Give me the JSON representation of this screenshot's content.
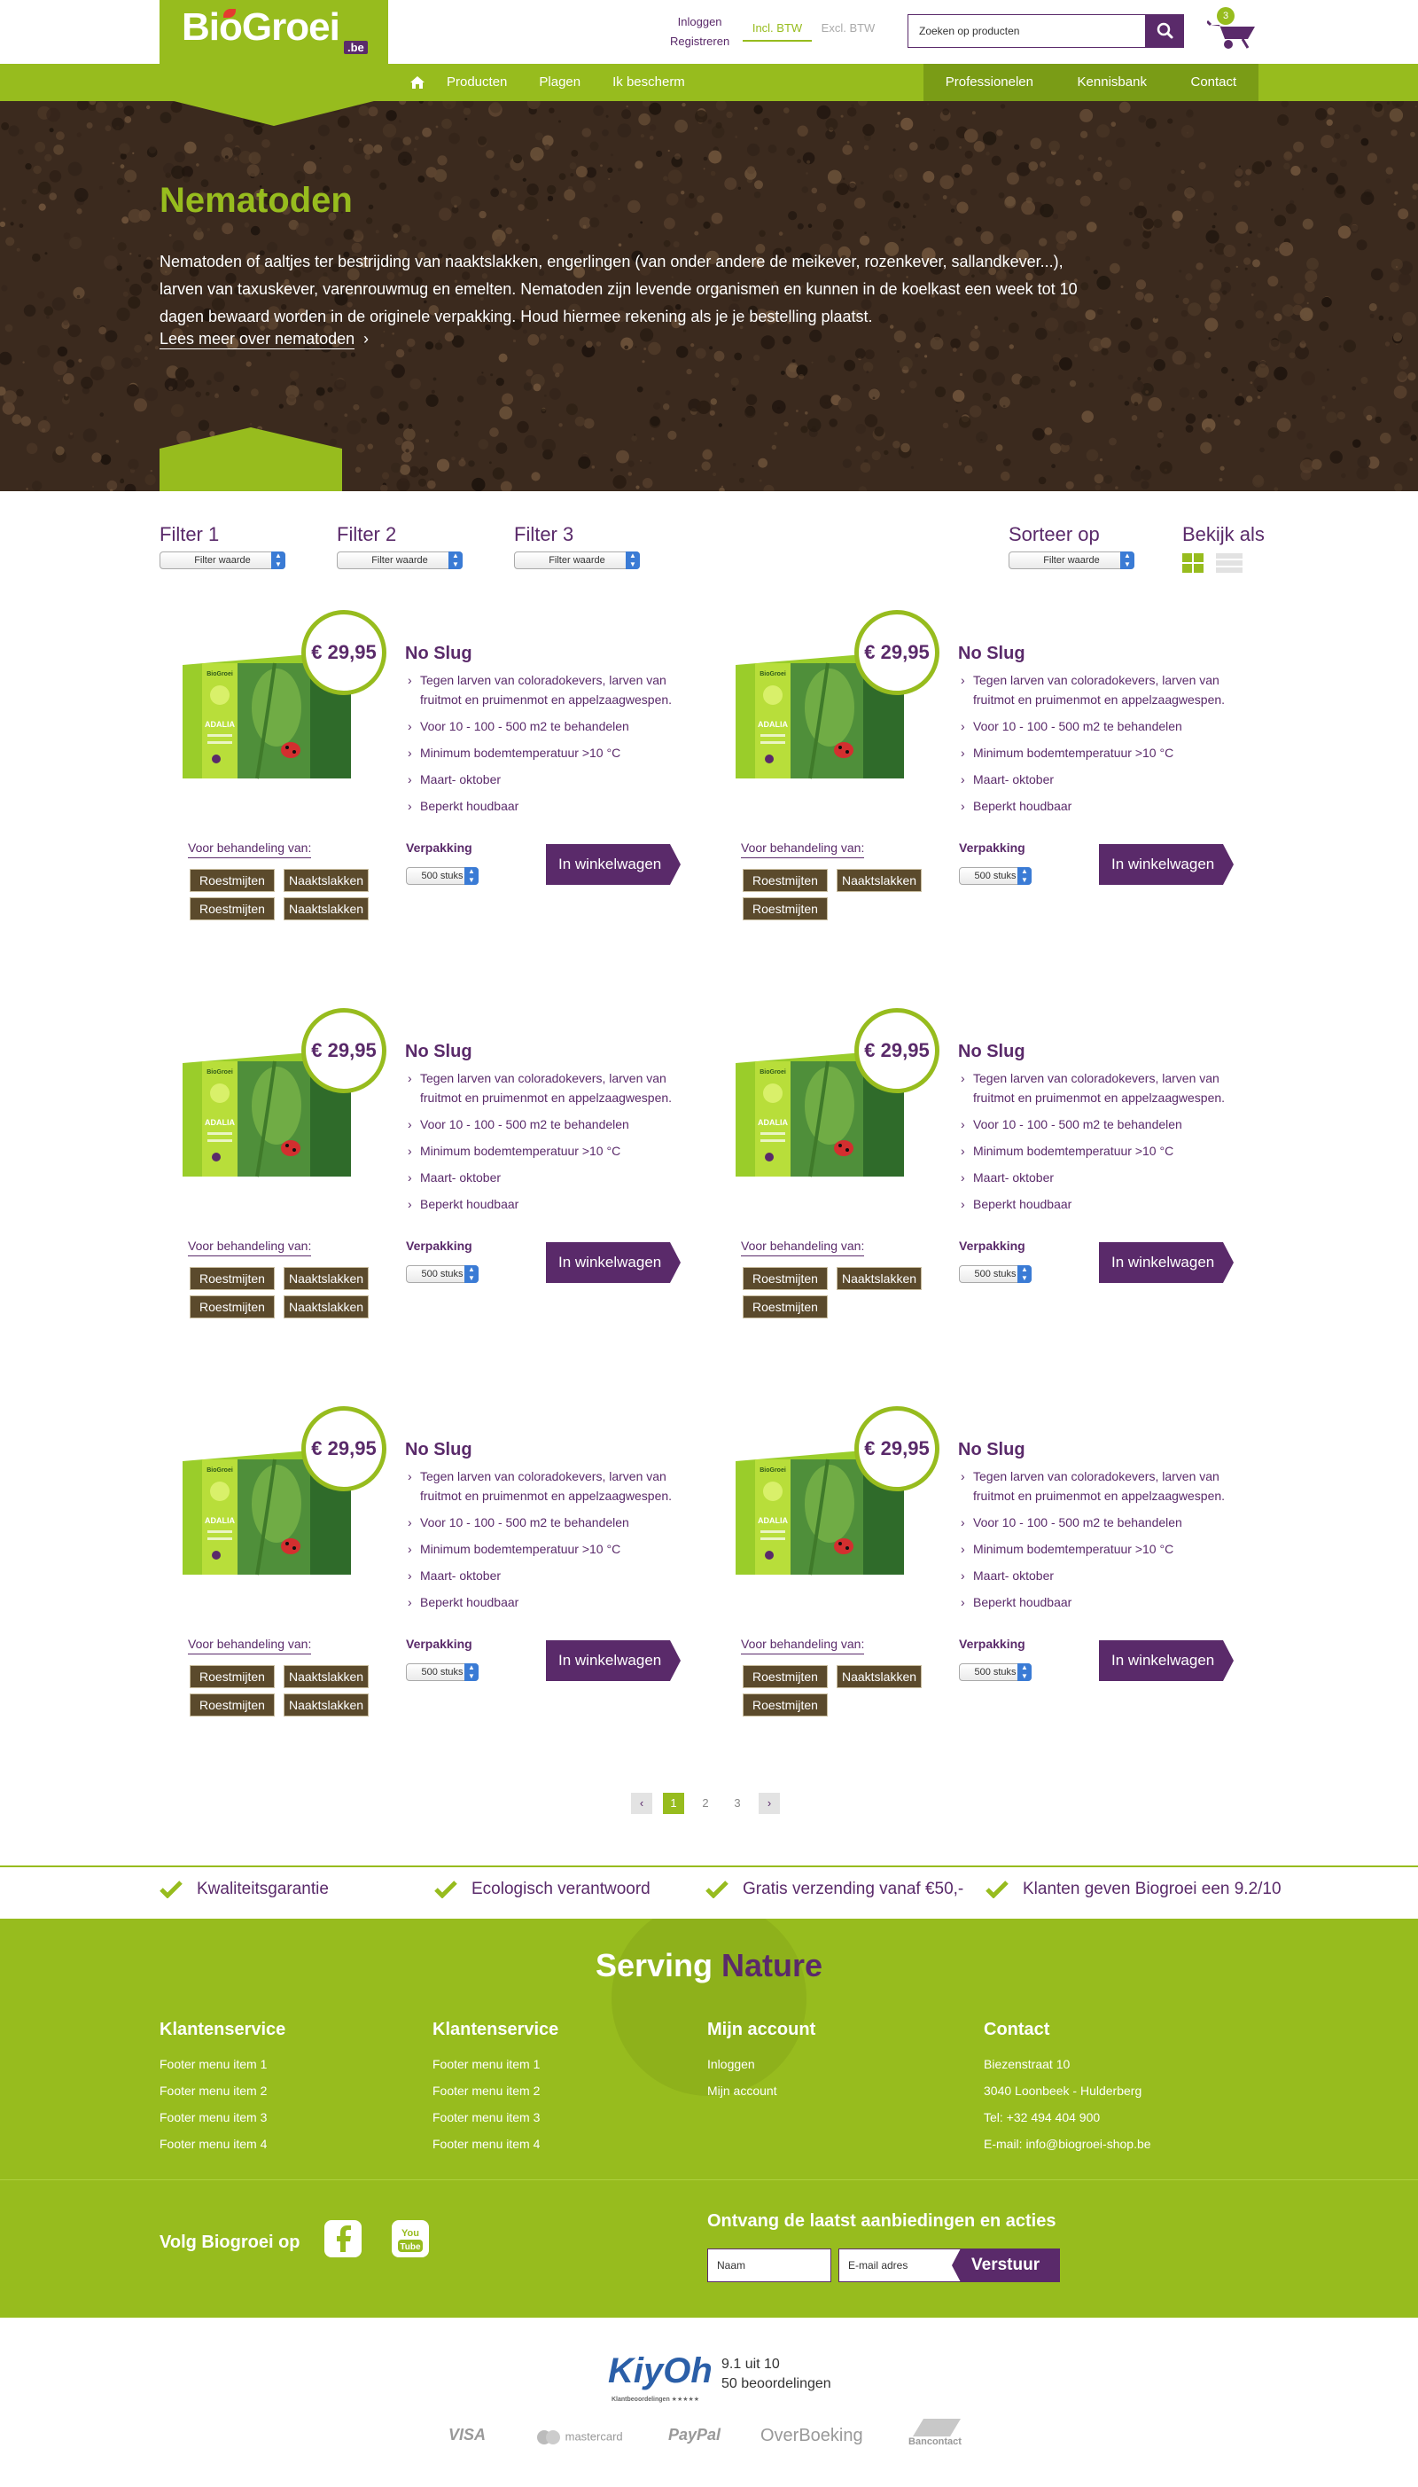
{
  "header": {
    "logo": {
      "bio": "Bio",
      "groei": "Groei",
      "be": ".be"
    },
    "login": "Inloggen",
    "register": "Registreren",
    "vat_incl": "Incl. BTW",
    "vat_excl": "Excl. BTW",
    "search_placeholder": "Zoeken op producten",
    "cart_count": "3"
  },
  "nav": {
    "left": [
      "Producten",
      "Plagen",
      "Ik bescherm"
    ],
    "right": [
      "Professionelen",
      "Kennisbank",
      "Contact"
    ]
  },
  "hero": {
    "title": "Nematoden",
    "text": "Nematoden of aaltjes ter bestrijding van naaktslakken, engerlingen (van onder andere de meikever, rozenkever, sallandkever...), larven van taxuskever, varenrouwmug en emelten. Nematoden zijn levende organismen en kunnen in de koelkast een week tot 10 dagen bewaard worden in de originele verpakking. Houd hiermee rekening als je je bestelling plaatst.",
    "more_link": "Lees meer over nematoden"
  },
  "filters": {
    "items": [
      {
        "label": "Filter 1",
        "value": "Filter waarde"
      },
      {
        "label": "Filter 2",
        "value": "Filter waarde"
      },
      {
        "label": "Filter 3",
        "value": "Filter waarde"
      }
    ],
    "sort": {
      "label": "Sorteer op",
      "value": "Filter waarde"
    },
    "view_as": "Bekijk als"
  },
  "products": [
    {
      "price": "€ 29,95",
      "name": "No Slug",
      "features": [
        "Tegen larven van coloradokevers, larven van fruitmot en pruimenmot en appelzaagwespen.",
        "Voor 10 - 100 - 500 m2 te behandelen",
        "Minimum bodemtemperatuur >10 °C",
        "Maart- oktober",
        "Beperkt houdbaar"
      ],
      "treatment_label": "Voor behandeling van:",
      "tags": [
        "Roestmijten",
        "Naaktslakken",
        "Roestmijten",
        "Naaktslakken"
      ],
      "packaging_label": "Verpakking",
      "packaging_value": "500 stuks",
      "cart_label": "In winkelwagen",
      "box": {
        "brand": "BioGroei",
        "title": "ADALIA"
      }
    },
    {
      "price": "€ 29,95",
      "name": "No Slug",
      "features": [
        "Tegen larven van coloradokevers, larven van fruitmot en pruimenmot en appelzaagwespen.",
        "Voor 10 - 100 - 500 m2 te behandelen",
        "Minimum bodemtemperatuur >10 °C",
        "Maart- oktober",
        "Beperkt houdbaar"
      ],
      "treatment_label": "Voor behandeling van:",
      "tags": [
        "Roestmijten",
        "Naaktslakken",
        "Roestmijten"
      ],
      "packaging_label": "Verpakking",
      "packaging_value": "500 stuks",
      "cart_label": "In winkelwagen",
      "box": {
        "brand": "BioGroei",
        "title": "ADALIA"
      }
    },
    {
      "price": "€ 29,95",
      "name": "No Slug",
      "features": [
        "Tegen larven van coloradokevers, larven van fruitmot en pruimenmot en appelzaagwespen.",
        "Voor 10 - 100 - 500 m2 te behandelen",
        "Minimum bodemtemperatuur >10 °C",
        "Maart- oktober",
        "Beperkt houdbaar"
      ],
      "treatment_label": "Voor behandeling van:",
      "tags": [
        "Roestmijten",
        "Naaktslakken",
        "Roestmijten",
        "Naaktslakken"
      ],
      "packaging_label": "Verpakking",
      "packaging_value": "500 stuks",
      "cart_label": "In winkelwagen",
      "box": {
        "brand": "BioGroei",
        "title": "ADALIA"
      }
    },
    {
      "price": "€ 29,95",
      "name": "No Slug",
      "features": [
        "Tegen larven van coloradokevers, larven van fruitmot en pruimenmot en appelzaagwespen.",
        "Voor 10 - 100 - 500 m2 te behandelen",
        "Minimum bodemtemperatuur >10 °C",
        "Maart- oktober",
        "Beperkt houdbaar"
      ],
      "treatment_label": "Voor behandeling van:",
      "tags": [
        "Roestmijten",
        "Naaktslakken",
        "Roestmijten"
      ],
      "packaging_label": "Verpakking",
      "packaging_value": "500 stuks",
      "cart_label": "In winkelwagen",
      "box": {
        "brand": "BioGroei",
        "title": "ADALIA"
      }
    },
    {
      "price": "€ 29,95",
      "name": "No Slug",
      "features": [
        "Tegen larven van coloradokevers, larven van fruitmot en pruimenmot en appelzaagwespen.",
        "Voor 10 - 100 - 500 m2 te behandelen",
        "Minimum bodemtemperatuur >10 °C",
        "Maart- oktober",
        "Beperkt houdbaar"
      ],
      "treatment_label": "Voor behandeling van:",
      "tags": [
        "Roestmijten",
        "Naaktslakken",
        "Roestmijten",
        "Naaktslakken"
      ],
      "packaging_label": "Verpakking",
      "packaging_value": "500 stuks",
      "cart_label": "In winkelwagen",
      "box": {
        "brand": "BioGroei",
        "title": "ADALIA"
      }
    },
    {
      "price": "€ 29,95",
      "name": "No Slug",
      "features": [
        "Tegen larven van coloradokevers, larven van fruitmot en pruimenmot en appelzaagwespen.",
        "Voor 10 - 100 - 500 m2 te behandelen",
        "Minimum bodemtemperatuur >10 °C",
        "Maart- oktober",
        "Beperkt houdbaar"
      ],
      "treatment_label": "Voor behandeling van:",
      "tags": [
        "Roestmijten",
        "Naaktslakken",
        "Roestmijten"
      ],
      "packaging_label": "Verpakking",
      "packaging_value": "500 stuks",
      "cart_label": "In winkelwagen",
      "box": {
        "brand": "BioGroei",
        "title": "ADALIA"
      }
    }
  ],
  "pagination": {
    "pages": [
      "1",
      "2",
      "3"
    ],
    "active": "1",
    "prev": "‹",
    "next": "›"
  },
  "usps": [
    "Kwaliteitsgarantie",
    "Ecologisch verantwoord",
    "Gratis verzending vanaf €50,-",
    "Klanten geven Biogroei een 9.2/10"
  ],
  "footer": {
    "slogan_a": "Serving",
    "slogan_b": "Nature",
    "columns": [
      {
        "title": "Klantenservice",
        "links": [
          "Footer menu item 1",
          "Footer menu item 2",
          "Footer menu item 3",
          "Footer menu item 4"
        ]
      },
      {
        "title": "Klantenservice",
        "links": [
          "Footer menu item 1",
          "Footer menu item 2",
          "Footer menu item 3",
          "Footer menu item 4"
        ]
      },
      {
        "title": "Mijn account",
        "links": [
          "Inloggen",
          "Mijn account"
        ]
      },
      {
        "title": "Contact",
        "links": [
          "Biezenstraat 10",
          "3040 Loonbeek - Hulderberg",
          "Tel: +32 494 404 900",
          "E-mail: info@biogroei-shop.be"
        ]
      }
    ],
    "follow": "Volg Biogroei op",
    "newsletter_title": "Ontvang de laatst aanbiedingen en acties",
    "name_placeholder": "Naam",
    "email_placeholder": "E-mail adres",
    "send_label": "Verstuur"
  },
  "bottom": {
    "kiyoh": "KiyOh",
    "kiyoh_sub": "Klantbeoordelingen ★★★★★",
    "score": "9.1 uit 10",
    "reviews": "50 beoordelingen",
    "payments": [
      "VISA",
      "mastercard",
      "PayPal",
      "OverBoeking",
      "Bancontact"
    ]
  },
  "colors": {
    "green": "#97bc1e",
    "dark_green": "#7a9c16",
    "purple": "#5a2a6a",
    "soil": "#3b2a1e"
  }
}
